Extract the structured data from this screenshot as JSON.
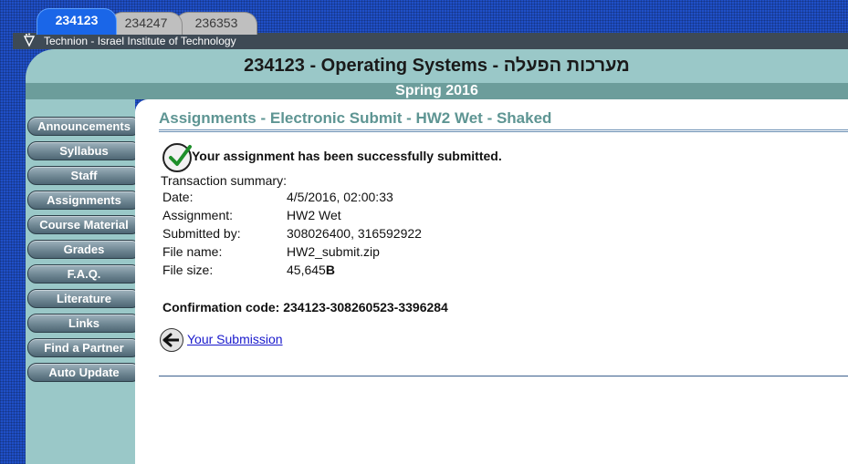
{
  "tabs": [
    {
      "label": "234123",
      "active": true
    },
    {
      "label": "234247",
      "active": false
    },
    {
      "label": "236353",
      "active": false
    }
  ],
  "institute": {
    "logo_icon": "technion-logo-icon",
    "name": "Technion - Israel Institute of Technology"
  },
  "header": {
    "course_title": "234123 - Operating Systems - מערכות הפעלה",
    "semester": "Spring 2016"
  },
  "sidebar": {
    "items": [
      {
        "label": "Announcements"
      },
      {
        "label": "Syllabus"
      },
      {
        "label": "Staff"
      },
      {
        "label": "Assignments"
      },
      {
        "label": "Course Material"
      },
      {
        "label": "Grades"
      },
      {
        "label": "F.A.Q."
      },
      {
        "label": "Literature"
      },
      {
        "label": "Links"
      },
      {
        "label": "Find a Partner"
      },
      {
        "label": "Auto Update"
      }
    ]
  },
  "main": {
    "page_title": "Assignments - Electronic Submit - HW2 Wet - Shaked",
    "success_message": "Your assignment has been successfully submitted.",
    "summary_label": "Transaction summary:",
    "details": [
      {
        "label": "Date:",
        "value": "4/5/2016, 02:00:33"
      },
      {
        "label": "Assignment:",
        "value": "HW2 Wet"
      },
      {
        "label": "Submitted by:",
        "value": "308026400, 316592922"
      },
      {
        "label": "File name:",
        "value": "HW2_submit.zip"
      }
    ],
    "file_size": {
      "label": "File size:",
      "value": "45,645",
      "unit": "B"
    },
    "confirmation": "Confirmation code: 234123-308260523-3396284",
    "submission_link": "Your Submission"
  },
  "colors": {
    "accent": "#1a66e8",
    "teal": "#9ac8c8",
    "title": "#5e9593"
  }
}
